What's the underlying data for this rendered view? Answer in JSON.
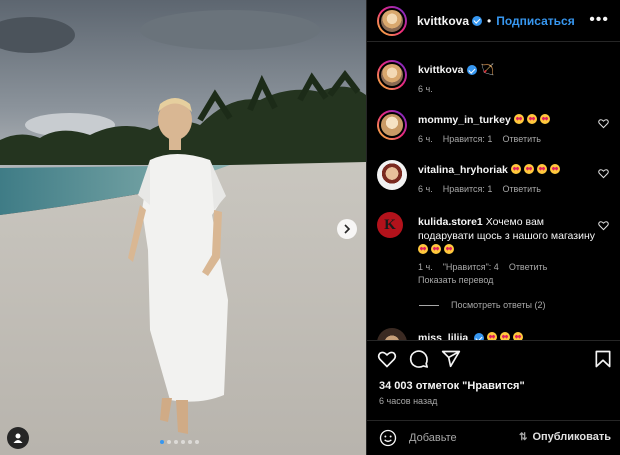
{
  "post": {
    "author": "kvittkova",
    "follow_label": "Подписаться",
    "caption_time": "6 ч.",
    "caption_emoji": "🏹",
    "photo_alt": "Woman in white dress on tropical beach"
  },
  "comments": [
    {
      "user": "mommy_in_turkey",
      "text": "",
      "emoji_count": 3,
      "time": "6 ч.",
      "likes": "Нравится: 1",
      "reply": "Ответить"
    },
    {
      "user": "vitalina_hryhoriak",
      "text": "",
      "emoji_count": 4,
      "time": "6 ч.",
      "likes": "Нравится: 1",
      "reply": "Ответить"
    },
    {
      "user": "kulida.store1",
      "text": "Хочемо вам подарувати щось з нашого магазину",
      "emoji_count": 3,
      "time": "1 ч.",
      "likes": "\"Нравится\": 4",
      "reply": "Ответить",
      "translate": "Показать перевод"
    },
    {
      "user": "miss_lilija"
    }
  ],
  "replies_label": "Посмотреть ответы (2)",
  "likes_line": "34 003 отметок \"Нравится\"",
  "posted_ago": "6 часов назад",
  "composer": {
    "placeholder": "Добавьте",
    "publish": "Опубликовать"
  },
  "colors": {
    "accent": "#3797f0",
    "background": "#000000",
    "muted": "#a8a8a8"
  },
  "icons": [
    "more-icon",
    "heart-icon",
    "comment-icon",
    "share-icon",
    "bookmark-icon",
    "smile-icon",
    "user-tag-icon",
    "next-arrow-icon"
  ],
  "carousel": {
    "slides": 6,
    "active": 1
  }
}
